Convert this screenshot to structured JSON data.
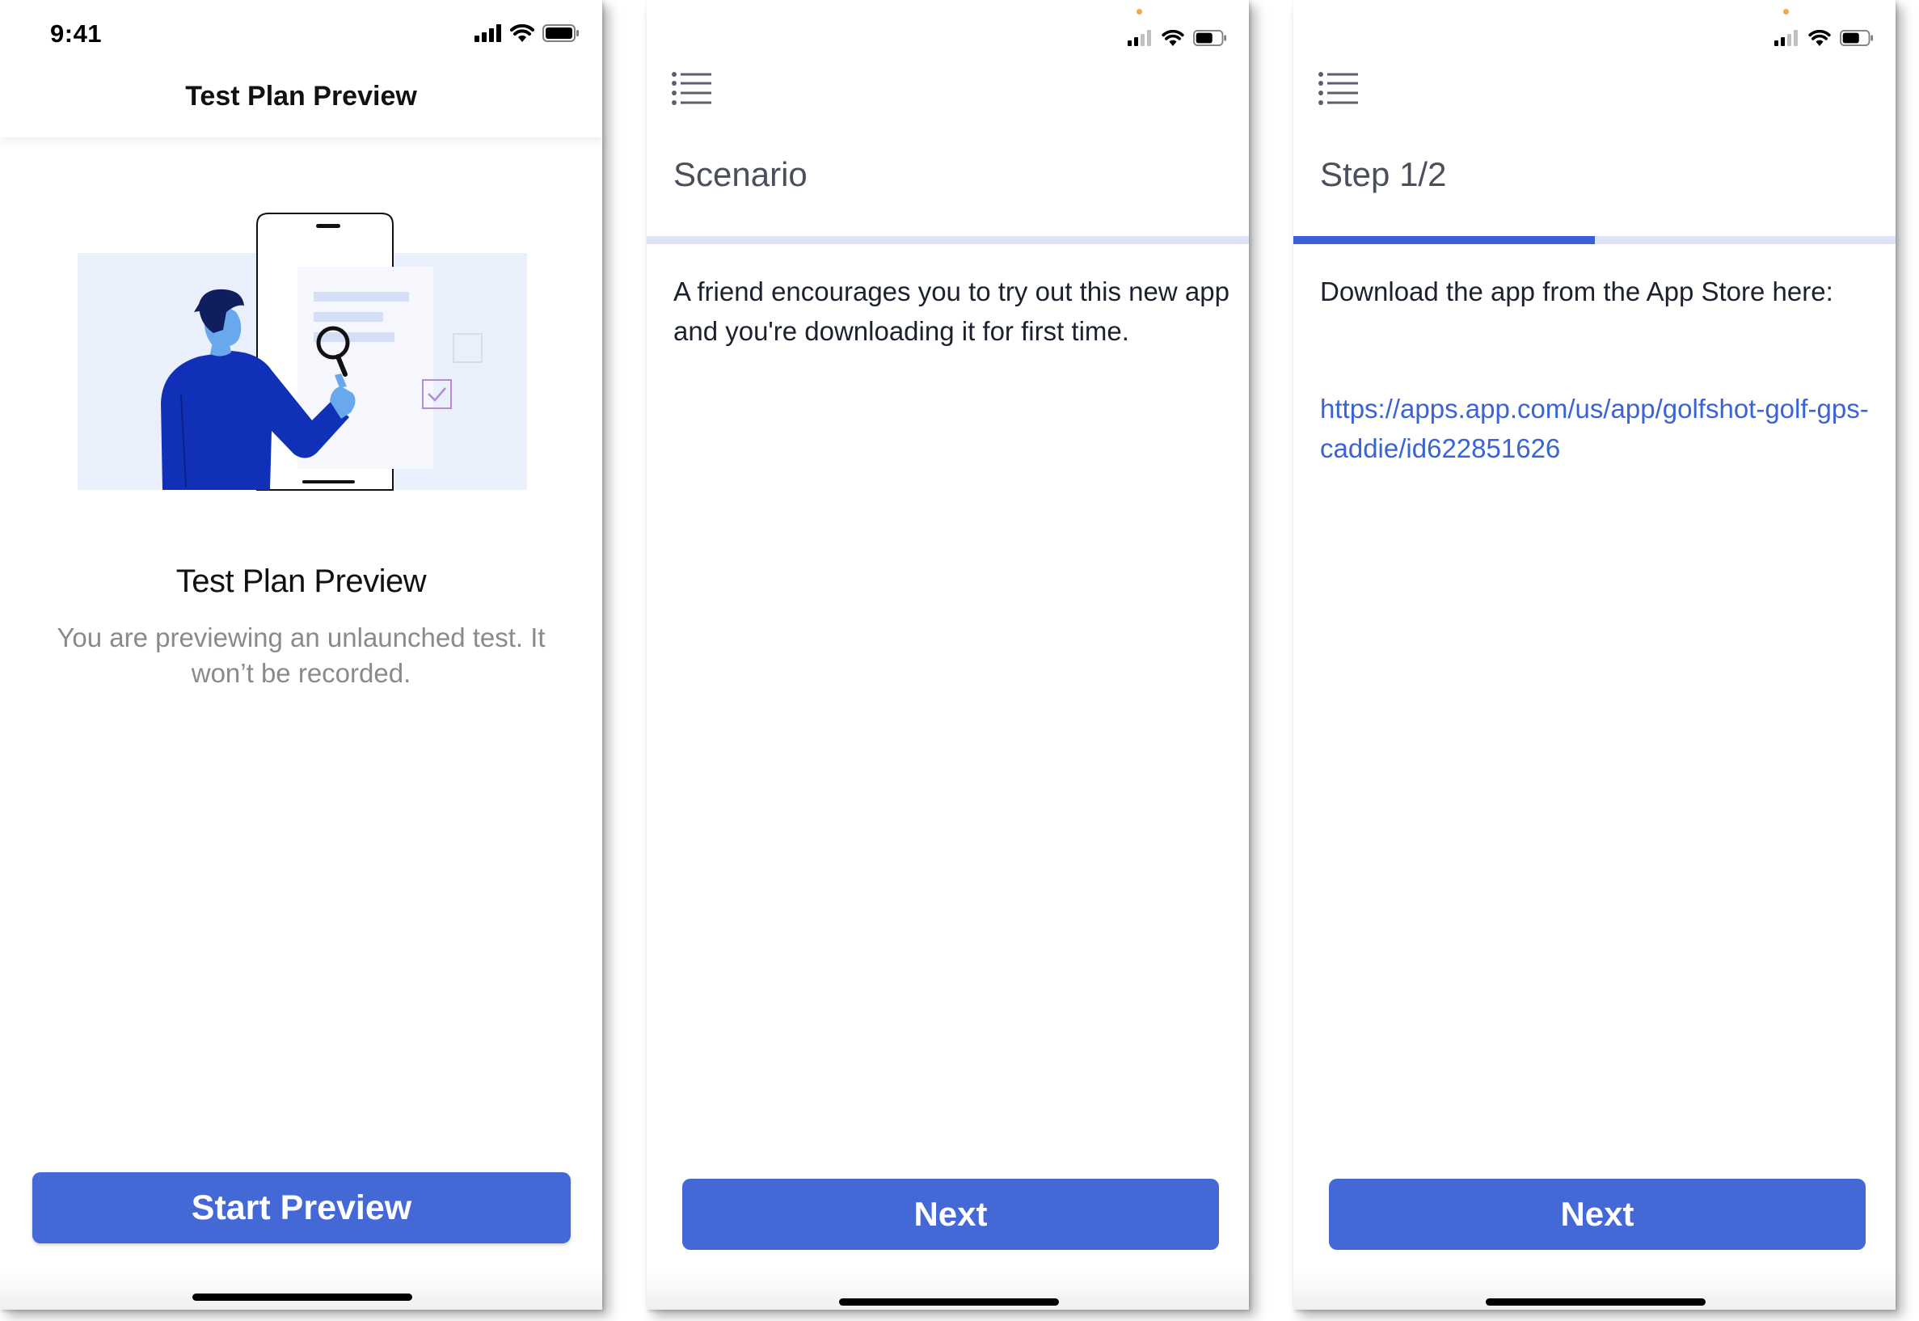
{
  "colors": {
    "accent": "#4468d6",
    "link": "#3a63d8",
    "progress_track": "#dfe3f6",
    "progress_fill": "#3c5fd6",
    "illustration_navy": "#1130b8",
    "illustration_light": "#e9f0fb"
  },
  "screen1": {
    "status_time": "9:41",
    "header_title": "Test Plan Preview",
    "preview_title": "Test Plan Preview",
    "preview_subtitle": "You are previewing an unlaunched test. It won’t be recorded.",
    "start_button_label": "Start Preview",
    "icons": [
      "signal-icon",
      "wifi-icon",
      "battery-icon"
    ]
  },
  "screen2": {
    "menu_icon": "list-menu-icon",
    "section_title": "Scenario",
    "progress": 0,
    "body_text": "A friend encourages you to try out this new app and you're downloading it for first time.",
    "next_button_label": "Next"
  },
  "screen3": {
    "menu_icon": "list-menu-icon",
    "section_title": "Step 1/2",
    "progress": 0.5,
    "body_text": "Download the app from the App Store here:",
    "link_text": "https://apps.app.com/us/app/golfshot-golf-gps-caddie/id622851626",
    "next_button_label": "Next"
  }
}
